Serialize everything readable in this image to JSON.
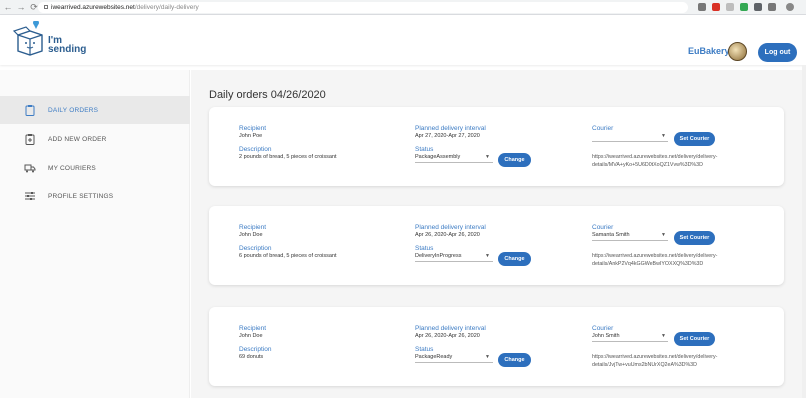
{
  "browser": {
    "back": "←",
    "forward": "→",
    "reload": "⟳",
    "url_host": "iwearrived.azurewebsites.net",
    "url_path": "/delivery/daily-delivery",
    "colors": [
      "#777777",
      "#d93025",
      "#bdbdbd",
      "#34a853",
      "#5f6368",
      "#777777"
    ]
  },
  "header": {
    "logo_line1": "I'm",
    "logo_line2": "sending",
    "company": "EuBakery",
    "logout_label": "Log out"
  },
  "sidebar": {
    "items": [
      {
        "label": "DAILY ORDERS",
        "icon": "clipboard-icon",
        "active": true
      },
      {
        "label": "ADD NEW ORDER",
        "icon": "add-clipboard-icon",
        "active": false
      },
      {
        "label": "MY COURIERS",
        "icon": "truck-icon",
        "active": false
      },
      {
        "label": "PROFILE SETTINGS",
        "icon": "sliders-icon",
        "active": false
      }
    ]
  },
  "main": {
    "title": "Daily orders 04/26/2020",
    "orders": [
      {
        "recipient_label": "Recipient",
        "recipient": "John Poe",
        "interval_label": "Planned delivery interval",
        "interval": "Apr 27, 2020-Apr 27, 2020",
        "courier_label": "Courier",
        "courier": "",
        "set_courier_label": "Set Courier",
        "description_label": "Description",
        "description": "2 pounds of bread, 5 pieces of croissant",
        "status_label": "Status",
        "status": "PackageAssembly",
        "change_label": "Change",
        "link": "https://iwearrived.azurewebsites.net/delivery/delivery-details/MVA+yKo+5U6D0tXoQZ1Vvw%3D%3D"
      },
      {
        "recipient_label": "Recipient",
        "recipient": "John Doe",
        "interval_label": "Planned delivery interval",
        "interval": "Apr 26, 2020-Apr 26, 2020",
        "courier_label": "Courier",
        "courier": "Samanta Smith",
        "set_courier_label": "Set Courier",
        "description_label": "Description",
        "description": "6 pounds of bread, 5 pieces of croissant",
        "status_label": "Status",
        "status": "DeliveryInProgress",
        "change_label": "Change",
        "link": "https://iwearrived.azurewebsites.net/delivery/delivery-details/AnkP2Vq4kGGWeBwIYOXXQ%3D%3D"
      },
      {
        "recipient_label": "Recipient",
        "recipient": "John Doe",
        "interval_label": "Planned delivery interval",
        "interval": "Apr 26, 2020-Apr 26, 2020",
        "courier_label": "Courier",
        "courier": "John Smith",
        "set_courier_label": "Set Courier",
        "description_label": "Description",
        "description": "69 donuts",
        "status_label": "Status",
        "status": "PackageReady",
        "change_label": "Change",
        "link": "https://iwearrived.azurewebsites.net/delivery/delivery-details/JvjTw+vuUms2bNUrXQ2eA%3D%3D"
      }
    ]
  },
  "colors": {
    "accent": "#3d7cc4",
    "button": "#2d6fbd",
    "page_bg": "#f5f5f5"
  }
}
